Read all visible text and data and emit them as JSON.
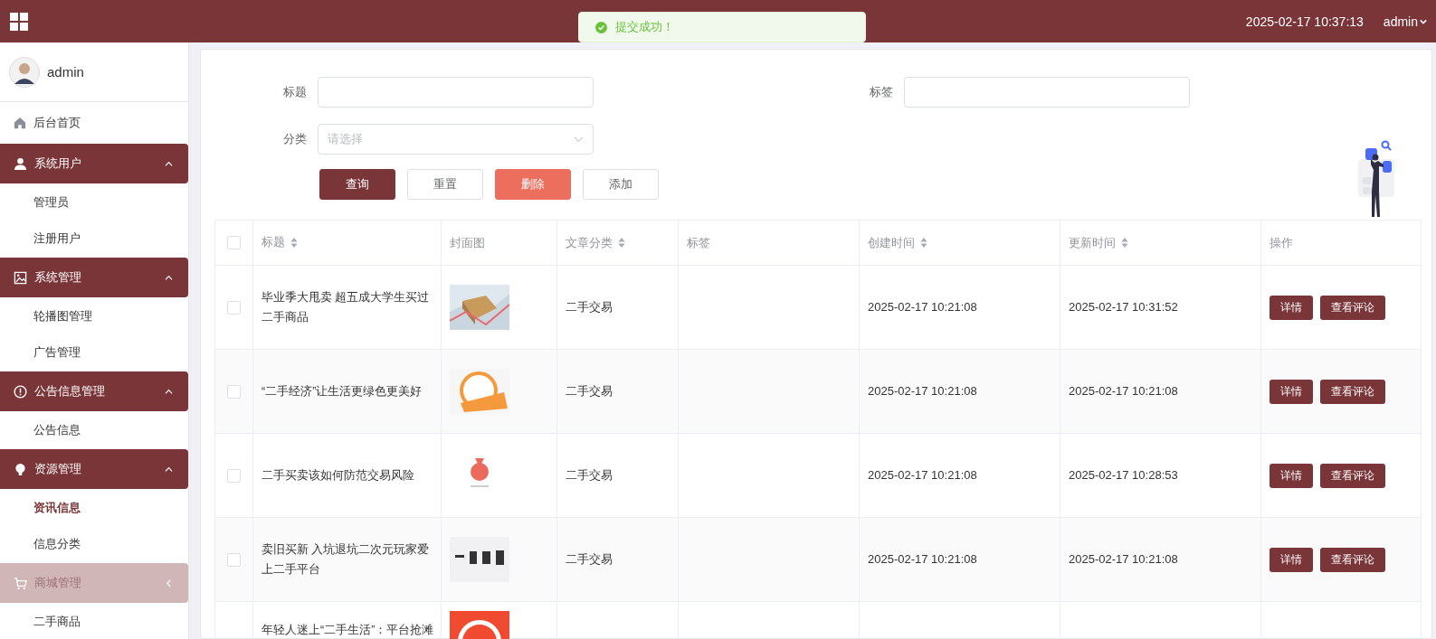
{
  "topbar": {
    "datetime": "2025-02-17 10:37:13",
    "user": "admin"
  },
  "toast": {
    "kind": "success",
    "message": "提交成功！"
  },
  "sidebar": {
    "user": "admin",
    "items": [
      {
        "kind": "link",
        "label": "后台首页"
      },
      {
        "kind": "group",
        "label": "系统用户",
        "expanded": true,
        "hovered": false,
        "children": [
          {
            "label": "管理员",
            "selected": false
          },
          {
            "label": "注册用户",
            "selected": false
          }
        ]
      },
      {
        "kind": "group",
        "label": "系统管理",
        "expanded": true,
        "hovered": false,
        "children": [
          {
            "label": "轮播图管理",
            "selected": false
          },
          {
            "label": "广告管理",
            "selected": false
          }
        ]
      },
      {
        "kind": "group",
        "label": "公告信息管理",
        "expanded": true,
        "hovered": false,
        "children": [
          {
            "label": "公告信息",
            "selected": false
          }
        ]
      },
      {
        "kind": "group",
        "label": "资源管理",
        "expanded": true,
        "hovered": false,
        "children": [
          {
            "label": "资讯信息",
            "selected": true
          },
          {
            "label": "信息分类",
            "selected": false
          }
        ]
      },
      {
        "kind": "group",
        "label": "商城管理",
        "expanded": false,
        "hovered": true,
        "children": [
          {
            "label": "二手商品",
            "selected": false
          }
        ]
      }
    ]
  },
  "filters": [
    {
      "kind": "input",
      "label": "标题"
    },
    {
      "kind": "input",
      "label": "标签"
    },
    {
      "kind": "select",
      "label": "分类",
      "placeholder": "请选择"
    }
  ],
  "buttons": [
    {
      "kind": "primary",
      "label": "查询"
    },
    {
      "kind": "default",
      "label": "重置"
    },
    {
      "kind": "danger",
      "label": "删除"
    },
    {
      "kind": "default",
      "label": "添加"
    }
  ],
  "table": {
    "header_checked": false,
    "columns": [
      {
        "label": "标题",
        "sortable": true
      },
      {
        "label": "封面图",
        "sortable": false
      },
      {
        "label": "文章分类",
        "sortable": true
      },
      {
        "label": "标签",
        "sortable": false
      },
      {
        "label": "创建时间",
        "sortable": true
      },
      {
        "label": "更新时间",
        "sortable": true
      },
      {
        "label": "操作",
        "sortable": false
      }
    ],
    "rows": [
      {
        "checked": false,
        "title": "毕业季大甩卖 超五成大学生买过二手商品",
        "category": "二手交易",
        "created": "2025-02-17 10:21:08",
        "updated": "2025-02-17 10:31:52",
        "actions": [
          "详情",
          "查看评论"
        ]
      },
      {
        "checked": false,
        "title": "“二手经济”让生活更绿色更美好",
        "category": "二手交易",
        "created": "2025-02-17 10:21:08",
        "updated": "2025-02-17 10:21:08",
        "actions": [
          "详情",
          "查看评论"
        ]
      },
      {
        "checked": false,
        "title": "二手买卖该如何防范交易风险",
        "category": "二手交易",
        "created": "2025-02-17 10:21:08",
        "updated": "2025-02-17 10:28:53",
        "actions": [
          "详情",
          "查看评论"
        ]
      },
      {
        "checked": false,
        "title": "卖旧买新 入坑退坑二次元玩家爱上二手平台",
        "category": "二手交易",
        "created": "2025-02-17 10:21:08",
        "updated": "2025-02-17 10:21:08",
        "actions": [
          "详情",
          "查看评论"
        ]
      },
      {
        "title": "年轻人迷上“二手生活”：平台抢滩"
      }
    ]
  }
}
